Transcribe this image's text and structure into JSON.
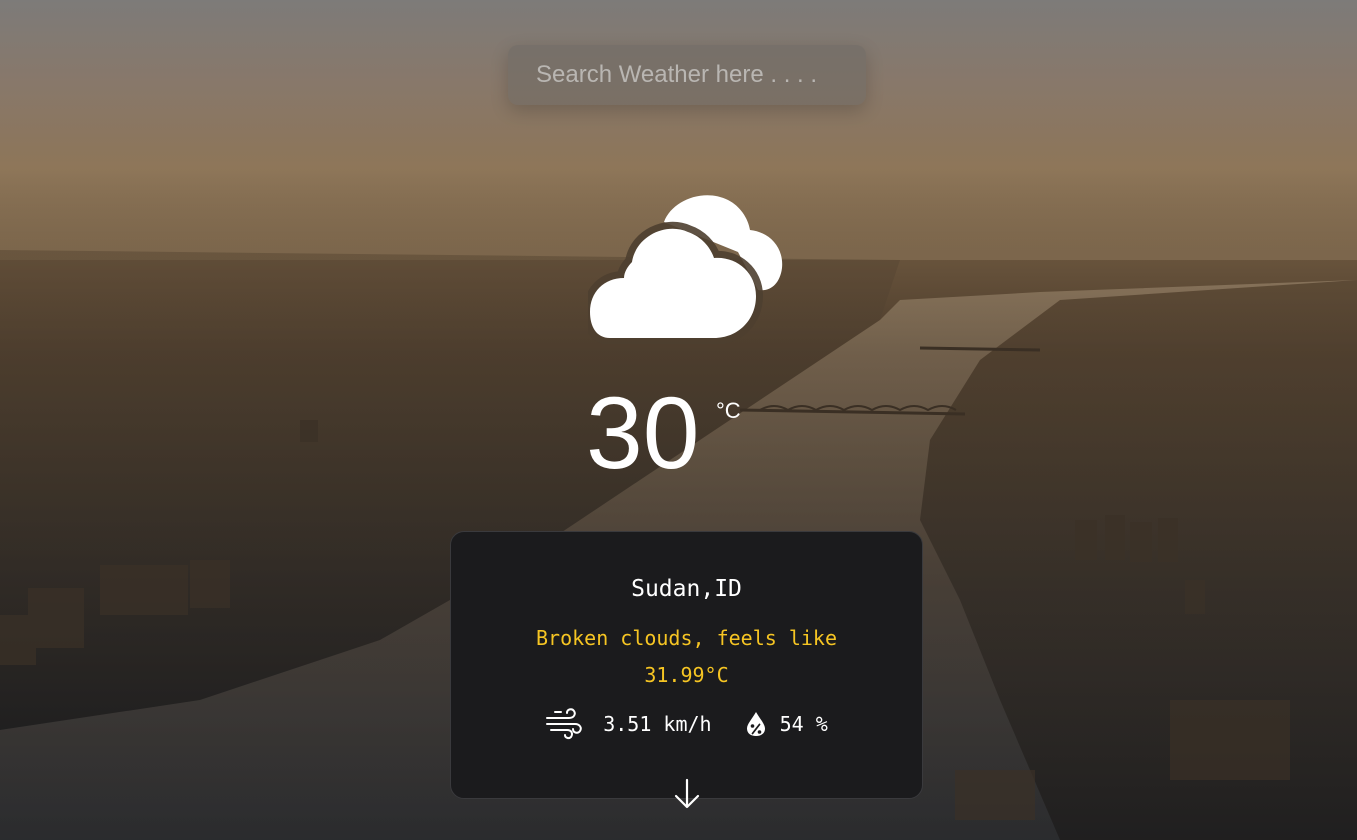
{
  "search": {
    "placeholder": "Search Weather here . . . ."
  },
  "current": {
    "icon": "broken-clouds-icon",
    "temperature": "30",
    "unit": "°C"
  },
  "details": {
    "location": "Sudan,ID",
    "condition_line1": "Broken clouds, feels like",
    "condition_line2": "31.99°C",
    "wind": "3.51 km/h",
    "wind_icon": "wind-icon",
    "humidity": "54 %",
    "humidity_icon": "humidity-drop-icon",
    "expand_icon": "arrow-down-icon"
  },
  "colors": {
    "accent": "#f6c523",
    "card_bg": "#1b1b1d",
    "text": "#ffffff"
  }
}
